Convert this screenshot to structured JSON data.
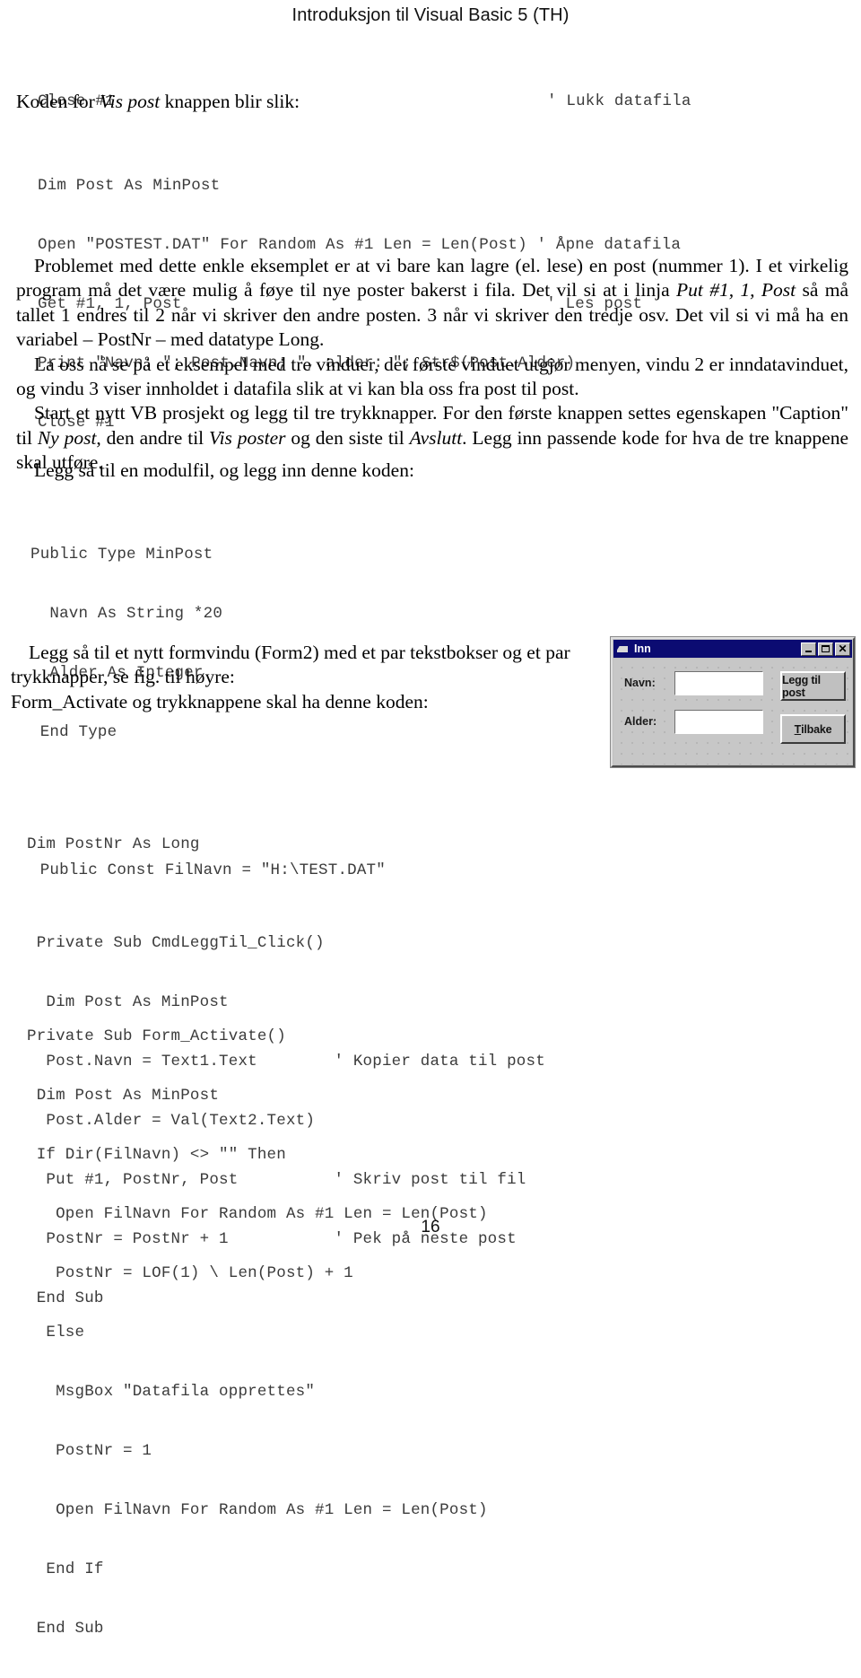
{
  "header": {
    "title": "Introduksjon til Visual Basic 5 (TH)"
  },
  "page_number": "16",
  "code_close": {
    "statement": "Close #1",
    "comment": "' Lukk datafila"
  },
  "lead_1": {
    "before": "Koden for ",
    "italic": "Vis post",
    "after": " knappen blir slik:"
  },
  "code_vispost": [
    "Dim Post As MinPost",
    "Open \"POSTEST.DAT\" For Random As #1 Len = Len(Post) ' Åpne datafila",
    "Get #1, 1, Post                                      ' Les post",
    "Print \"Navn: \"; Post.Navn; \", alder: \"; Str$(Post.Alder)",
    "Close #1"
  ],
  "paragraph_1": {
    "p1_a": "Problemet med dette enkle eksemplet er at vi bare kan lagre (el. lese) en  post (nummer 1). I et virkelig program må det være mulig å  føye til nye poster bakerst i fila. Det vil si at i linja  ",
    "p1_italic": "Put #1, 1, Post",
    "p1_b": " så må tallet 1 endres til 2 når vi  skriver den andre posten. 3 når vi skriver den tredje osv. Det vil  si vi må ha en variabel – PostNr – med datatype Long.",
    "p2": "La oss nå se på et eksempel med tre vinduer, det første  vinduet utgjør menyen, vindu 2 er inndatavinduet, og vindu 3 viser  innholdet i datafila slik at vi kan bla oss fra post til post.",
    "p3_a": "Start et nytt VB prosjekt og legg til tre trykknapper. For den første  knappen settes egenskapen \"Caption\" til ",
    "p3_i1": "Ny post",
    "p3_b": ", den andre  til ",
    "p3_i2": "Vis poster",
    "p3_c": " og den siste til ",
    "p3_i3": "Avslutt",
    "p3_d": ". Legg inn passende  kode for hva de tre knappene skal utføre."
  },
  "lead_2": "Legg så til en modulfil, og legg inn denne koden:",
  "code_module": [
    "Public Type MinPost",
    "  Navn As String *20",
    "  Alder As Integer",
    " End Type",
    "",
    "",
    " Public Const FilNavn = \"H:\\TEST.DAT\""
  ],
  "paragraph_2": {
    "p1": "Legg så til et nytt formvindu (Form2) med et par tekstbokser  og et par trykknapper, se fig. til høyre:",
    "p2": "Form_Activate og trykknappene skal ha denne koden:"
  },
  "code_form": [
    "Dim PostNr As Long",
    "",
    " Private Sub CmdLeggTil_Click()",
    "  Dim Post As MinPost",
    "  Post.Navn = Text1.Text        ' Kopier data til post",
    "  Post.Alder = Val(Text2.Text)",
    "  Put #1, PostNr, Post          ' Skriv post til fil",
    "  PostNr = PostNr + 1           ' Pek på neste post",
    " End Sub"
  ],
  "code_activate": [
    "Private Sub Form_Activate()",
    " Dim Post As MinPost",
    " If Dir(FilNavn) <> \"\" Then",
    "   Open FilNavn For Random As #1 Len = Len(Post)",
    "   PostNr = LOF(1) \\ Len(Post) + 1",
    "  Else",
    "   MsgBox \"Datafila opprettes\"",
    "   PostNr = 1",
    "   Open FilNavn For Random As #1 Len = Len(Post)",
    "  End If",
    " End Sub"
  ],
  "vb_form": {
    "title": "Inn",
    "minimize_label": "_",
    "maximize_label": "□",
    "close_label": "✕",
    "label_navn": "Navn:",
    "label_alder": "Alder:",
    "textbox_navn_value": "",
    "textbox_alder_value": "",
    "button_add_prefix": "Legg til post",
    "button_back_acc": "T",
    "button_back_rest": "ilbake",
    "titlebar_color": "#0b0b72",
    "face_color": "#c0c0c0"
  }
}
